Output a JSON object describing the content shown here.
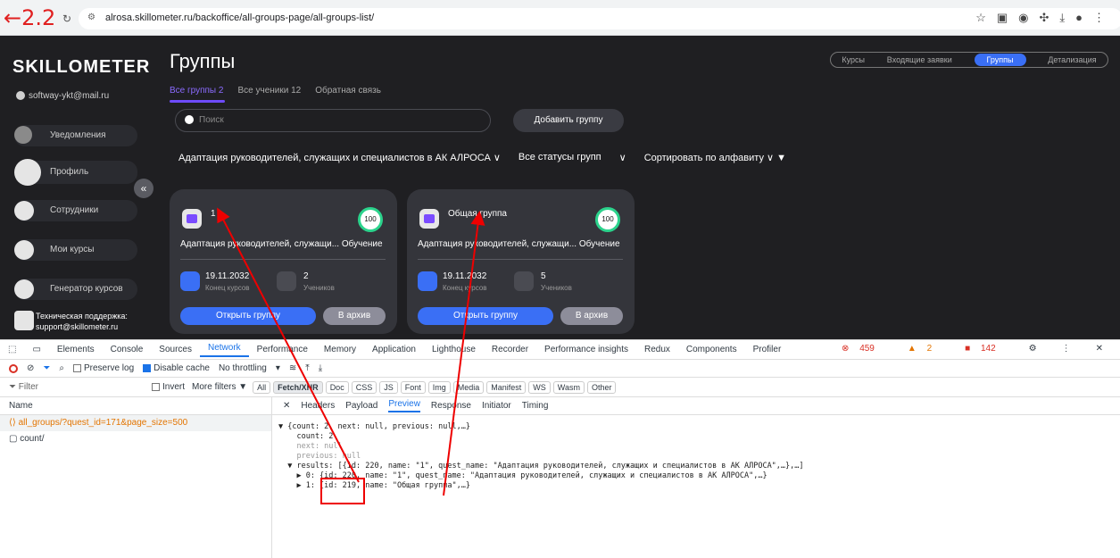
{
  "browser": {
    "nav_number": "2.2",
    "url": "alrosa.skillometer.ru/backoffice/all-groups-page/all-groups-list/"
  },
  "sidebar": {
    "logo": "SKILLOMETER",
    "user_email": "softway-ykt@mail.ru",
    "items": [
      {
        "label": "Уведомления",
        "icon": "bell-icon"
      },
      {
        "label": "Профиль",
        "icon": "avatar-icon"
      },
      {
        "label": "Сотрудники",
        "icon": "employees-icon"
      },
      {
        "label": "Мои курсы",
        "icon": "courses-icon"
      },
      {
        "label": "Генератор курсов",
        "icon": "generator-icon"
      }
    ],
    "support_line1": "Техническая поддержка:",
    "support_line2": "support@skillometer.ru"
  },
  "main": {
    "title": "Группы",
    "top_tabs": [
      "Курсы",
      "Входящие заявки",
      "Группы",
      "Детализация"
    ],
    "active_top_tab": "Группы",
    "subtabs": [
      "Все группы 2",
      "Все ученики 12",
      "Обратная связь"
    ],
    "search_placeholder": "Поиск",
    "add_group": "Добавить группу",
    "filter_course": "Адаптация руководителей, служащих и специалистов в АК АЛРОСА ∨",
    "filter_status": "Все статусы групп",
    "filter_status_chevron": "∨",
    "filter_sort": "Сортировать по алфавиту ∨ ▼"
  },
  "cards": [
    {
      "name": "1",
      "progress": "100",
      "course": "Адаптация руководителей, служащи... Обучение",
      "date": "19.11.2032",
      "date_label": "Конец курсов",
      "students": "2",
      "students_label": "Учеников",
      "open": "Открыть группу",
      "archive": "В архив"
    },
    {
      "name": "Общая группа",
      "progress": "100",
      "course": "Адаптация руководителей, служащи... Обучение",
      "date": "19.11.2032",
      "date_label": "Конец курсов",
      "students": "5",
      "students_label": "Учеников",
      "open": "Открыть группу",
      "archive": "В архив"
    }
  ],
  "devtools": {
    "tabs": [
      "Elements",
      "Console",
      "Sources",
      "Network",
      "Performance",
      "Memory",
      "Application",
      "Lighthouse",
      "Recorder",
      "Performance insights",
      "Redux",
      "Components",
      "Profiler"
    ],
    "active_tab": "Network",
    "counts": {
      "errors": "459",
      "warnings": "2",
      "issues": "142"
    },
    "toolbar": {
      "preserve_log": "Preserve log",
      "disable_cache": "Disable cache",
      "throttling": "No throttling"
    },
    "filter": {
      "placeholder": "Filter",
      "invert": "Invert",
      "more_filters": "More filters ▼"
    },
    "chips": [
      "All",
      "Fetch/XHR",
      "Doc",
      "CSS",
      "JS",
      "Font",
      "Img",
      "Media",
      "Manifest",
      "WS",
      "Wasm",
      "Other"
    ],
    "active_chip": "Fetch/XHR",
    "name_header": "Name",
    "requests": [
      "all_groups/?quest_id=171&page_size=500",
      "count/"
    ],
    "detail_tabs": [
      "Headers",
      "Payload",
      "Preview",
      "Response",
      "Initiator",
      "Timing"
    ],
    "active_detail_tab": "Preview",
    "preview_lines": [
      "▼ {count: 2, next: null, previous: null,…}",
      "    count: 2",
      "    next: null",
      "    previous: null",
      "  ▼ results: [{id: 220, name: \"1\", quest_name: \"Адаптация руководителей, служащих и специалистов в АК АЛРОСА\",…},…]",
      "    ▶ 0: {id: 220, name: \"1\", quest_name: \"Адаптация руководителей, служащих и специалистов в АК АЛРОСА\",…}",
      "    ▶ 1: {id: 219, name: \"Общая группа\",…}"
    ]
  }
}
